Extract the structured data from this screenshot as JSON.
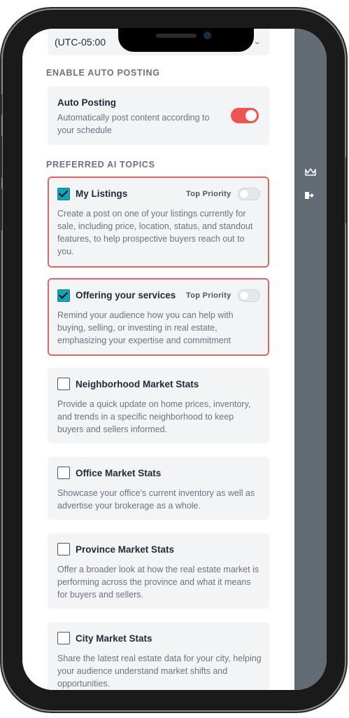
{
  "timezone": {
    "value": "(UTC-05:00",
    "chevron": "chevron-down-icon"
  },
  "auto_posting_section": {
    "label": "ENABLE AUTO POSTING",
    "title": "Auto Posting",
    "description": "Automatically post content according to your schedule",
    "enabled": true,
    "toggle_color": "#ef5350"
  },
  "topics_section": {
    "label": "PREFERRED AI TOPICS",
    "priority_label": "Top Priority",
    "selected_border_color": "#e06666",
    "checkbox_color": "#14a3b8",
    "topics": [
      {
        "title": "My Listings",
        "checked": true,
        "top_priority": false,
        "description": "Create a post on one of your listings currently for sale, including price, location, status, and standout features, to help prospective buyers reach out to you."
      },
      {
        "title": "Offering your services",
        "checked": true,
        "top_priority": false,
        "description": "Remind your audience how you can help with buying, selling, or investing in real estate, emphasizing your expertise and commitment"
      },
      {
        "title": "Neighborhood Market Stats",
        "checked": false,
        "description": "Provide a quick update on home prices, inventory, and trends in a specific neighborhood to keep buyers and sellers informed."
      },
      {
        "title": "Office Market Stats",
        "checked": false,
        "description": "Showcase your office's current inventory as well as advertise your brokerage as a whole."
      },
      {
        "title": "Province Market Stats",
        "checked": false,
        "description": "Offer a broader look at how the real estate market is performing across the province and what it means for buyers and sellers."
      },
      {
        "title": "City Market Stats",
        "checked": false,
        "description": "Share the latest real estate data for your city, helping your audience understand market shifts and opportunities."
      }
    ]
  },
  "rail": {
    "icons": [
      "crown-icon",
      "logout-icon"
    ],
    "background": "#636b75"
  }
}
